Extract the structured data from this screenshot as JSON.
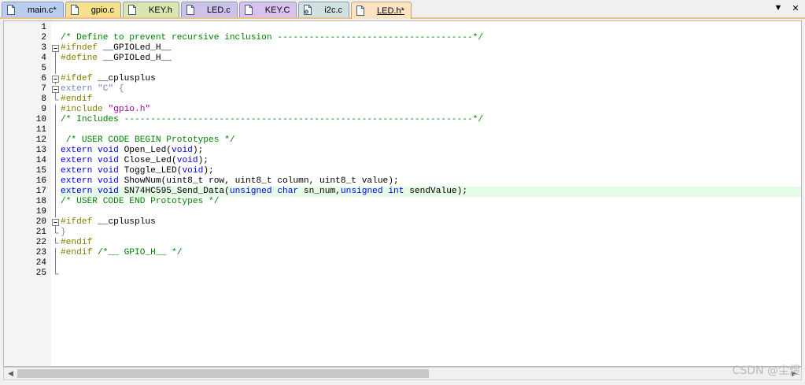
{
  "tabs": [
    {
      "label": "main.c*",
      "color": "#b8cdf0",
      "icon": "file-icon",
      "active": false
    },
    {
      "label": "gpio.c",
      "color": "#f5e08c",
      "icon": "file-icon",
      "active": false
    },
    {
      "label": "KEY.h",
      "color": "#d8e6b0",
      "icon": "file-icon",
      "active": false
    },
    {
      "label": "LED.c",
      "color": "#cdc2ea",
      "icon": "file-icon",
      "active": false
    },
    {
      "label": "KEY.C",
      "color": "#d9c2ee",
      "icon": "file-icon",
      "active": false
    },
    {
      "label": "i2c.c",
      "color": "#cfe2e0",
      "icon": "gear-file-icon",
      "active": false
    },
    {
      "label": "LED.h*",
      "color": "#fbe3c4",
      "icon": "file-icon",
      "active": true
    }
  ],
  "window_controls": {
    "dropdown": "▼",
    "close": "✕"
  },
  "editor": {
    "highlight_color": "#e6fbe6",
    "lines": [
      {
        "n": "1",
        "fold": "",
        "tokens": []
      },
      {
        "n": "2",
        "fold": "",
        "tokens": [
          {
            "t": "/* Define to prevent recursive inclusion -------------------------------------*/",
            "c": "t-comment"
          }
        ]
      },
      {
        "n": "3",
        "fold": "box",
        "tokens": [
          {
            "t": "#ifndef",
            "c": "t-pre"
          },
          {
            "t": " __GPIOLed_H__",
            "c": "t-id"
          }
        ]
      },
      {
        "n": "4",
        "fold": "line",
        "tokens": [
          {
            "t": "#define",
            "c": "t-pre"
          },
          {
            "t": " __GPIOLed_H__",
            "c": "t-id"
          }
        ]
      },
      {
        "n": "5",
        "fold": "line",
        "tokens": []
      },
      {
        "n": "6",
        "fold": "box",
        "tokens": [
          {
            "t": "#ifdef",
            "c": "t-pre"
          },
          {
            "t": " __cplusplus",
            "c": "t-id"
          }
        ]
      },
      {
        "n": "7",
        "fold": "box",
        "tokens": [
          {
            "t": "extern",
            "c": "t-muted"
          },
          {
            "t": " ",
            "c": "t-id"
          },
          {
            "t": "\"C\"",
            "c": "t-muted"
          },
          {
            "t": " {",
            "c": "t-muted"
          }
        ]
      },
      {
        "n": "8",
        "fold": "end",
        "tokens": [
          {
            "t": "#endif",
            "c": "t-pre"
          }
        ]
      },
      {
        "n": "9",
        "fold": "line",
        "tokens": [
          {
            "t": "#include",
            "c": "t-pre"
          },
          {
            "t": " ",
            "c": "t-id"
          },
          {
            "t": "\"gpio.h\"",
            "c": "t-str"
          }
        ]
      },
      {
        "n": "10",
        "fold": "line",
        "tokens": [
          {
            "t": "/* Includes ------------------------------------------------------------------*/",
            "c": "t-comment"
          }
        ]
      },
      {
        "n": "11",
        "fold": "line",
        "tokens": []
      },
      {
        "n": "12",
        "fold": "line",
        "tokens": [
          {
            "t": " /* USER CODE BEGIN Prototypes */",
            "c": "t-comment"
          }
        ]
      },
      {
        "n": "13",
        "fold": "line",
        "tokens": [
          {
            "t": "extern",
            "c": "t-kw"
          },
          {
            "t": " ",
            "c": "t-id"
          },
          {
            "t": "void",
            "c": "t-kw"
          },
          {
            "t": " Open_Led(",
            "c": "t-id"
          },
          {
            "t": "void",
            "c": "t-kw"
          },
          {
            "t": ");",
            "c": "t-id"
          }
        ]
      },
      {
        "n": "14",
        "fold": "line",
        "tokens": [
          {
            "t": "extern",
            "c": "t-kw"
          },
          {
            "t": " ",
            "c": "t-id"
          },
          {
            "t": "void",
            "c": "t-kw"
          },
          {
            "t": " Close_Led(",
            "c": "t-id"
          },
          {
            "t": "void",
            "c": "t-kw"
          },
          {
            "t": ");",
            "c": "t-id"
          }
        ]
      },
      {
        "n": "15",
        "fold": "line",
        "tokens": [
          {
            "t": "extern",
            "c": "t-kw"
          },
          {
            "t": " ",
            "c": "t-id"
          },
          {
            "t": "void",
            "c": "t-kw"
          },
          {
            "t": " Toggle_LED(",
            "c": "t-id"
          },
          {
            "t": "void",
            "c": "t-kw"
          },
          {
            "t": ");",
            "c": "t-id"
          }
        ]
      },
      {
        "n": "16",
        "fold": "line",
        "tokens": [
          {
            "t": "extern",
            "c": "t-kw"
          },
          {
            "t": " ",
            "c": "t-id"
          },
          {
            "t": "void",
            "c": "t-kw"
          },
          {
            "t": " ShowNum(uint8_t row, uint8_t column, uint8_t value);",
            "c": "t-id"
          }
        ]
      },
      {
        "n": "17",
        "fold": "line",
        "highlight": true,
        "tokens": [
          {
            "t": "extern",
            "c": "t-kw"
          },
          {
            "t": " ",
            "c": "t-id"
          },
          {
            "t": "void",
            "c": "t-kw"
          },
          {
            "t": " SN74HC595_Send_Data(",
            "c": "t-id"
          },
          {
            "t": "unsigned",
            "c": "t-kw"
          },
          {
            "t": " ",
            "c": "t-id"
          },
          {
            "t": "char",
            "c": "t-kw"
          },
          {
            "t": " sn_num,",
            "c": "t-id"
          },
          {
            "t": "unsigned",
            "c": "t-kw"
          },
          {
            "t": " ",
            "c": "t-id"
          },
          {
            "t": "int",
            "c": "t-kw"
          },
          {
            "t": " sendValue);",
            "c": "t-id"
          }
        ]
      },
      {
        "n": "18",
        "fold": "line",
        "tokens": [
          {
            "t": "/* USER CODE END Prototypes */",
            "c": "t-comment"
          }
        ]
      },
      {
        "n": "19",
        "fold": "line",
        "tokens": []
      },
      {
        "n": "20",
        "fold": "box",
        "tokens": [
          {
            "t": "#ifdef",
            "c": "t-pre"
          },
          {
            "t": " __cplusplus",
            "c": "t-id"
          }
        ]
      },
      {
        "n": "21",
        "fold": "end",
        "tokens": [
          {
            "t": "}",
            "c": "t-muted"
          }
        ]
      },
      {
        "n": "22",
        "fold": "end",
        "tokens": [
          {
            "t": "#endif",
            "c": "t-pre"
          }
        ]
      },
      {
        "n": "23",
        "fold": "line",
        "tokens": [
          {
            "t": "#endif",
            "c": "t-pre"
          },
          {
            "t": " ",
            "c": "t-id"
          },
          {
            "t": "/*__ GPIO_H__ */",
            "c": "t-comment"
          }
        ]
      },
      {
        "n": "24",
        "fold": "line",
        "tokens": []
      },
      {
        "n": "25",
        "fold": "end",
        "tokens": []
      }
    ]
  },
  "scrollbar": {
    "left_arrow": "◀",
    "right_arrow": "▶"
  },
  "watermark": "CSDN @尘煜"
}
